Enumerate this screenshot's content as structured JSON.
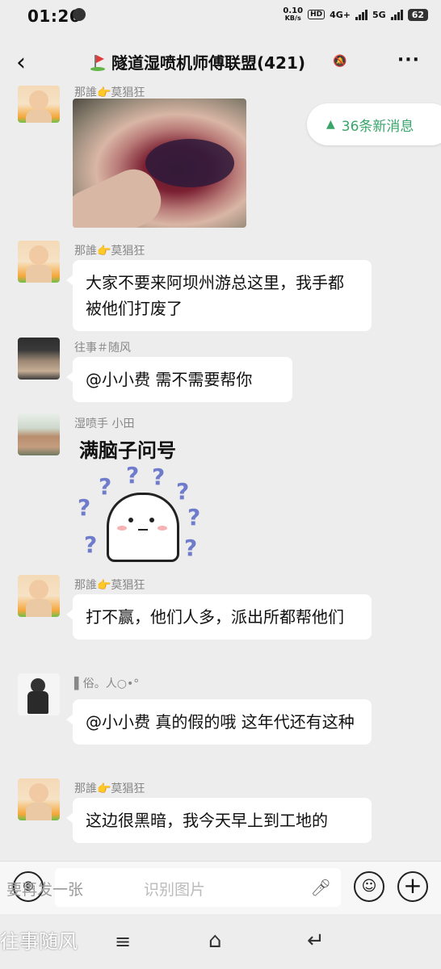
{
  "status_bar": {
    "time": "01:26",
    "net_speed_value": "0.10",
    "net_speed_unit": "KB/s",
    "hd_label": "HD",
    "sim1": "4G+",
    "sim2": "5G",
    "battery": "62"
  },
  "header": {
    "title": "隧道湿喷机师傅联盟(421)",
    "back_icon": "back-arrow-icon",
    "more_icon": "more-dots-icon"
  },
  "new_messages_badge": "36条新消息",
  "messages": [
    {
      "sender": "那誰👉莫猖狂",
      "type": "image"
    },
    {
      "sender": "那誰👉莫猖狂",
      "text": "大家不要来阿坝州游总这里，我手都被他们打废了"
    },
    {
      "sender": "往事＃随风",
      "text": "@小小费  需不需要帮你"
    },
    {
      "sender": "湿喷手  小田",
      "type": "sticker",
      "sticker_caption": "满脑子问号"
    },
    {
      "sender": "那誰👉莫猖狂",
      "text": "打不赢，他们人多，派出所都帮他们"
    },
    {
      "sender": "▌俗。人○•°",
      "text": "@小小费  真的假的哦      这年代还有这种"
    },
    {
      "sender": "那誰👉莫猖狂",
      "text": "这边很黑暗，我今天早上到工地的"
    }
  ],
  "input_bar": {
    "placeholder_left": "要再发一张",
    "placeholder_right": "识别图片"
  },
  "watermark": "往事随风",
  "colors": {
    "accent_green": "#3aa56b",
    "chat_background": "#ededed",
    "bubble": "#ffffff"
  }
}
